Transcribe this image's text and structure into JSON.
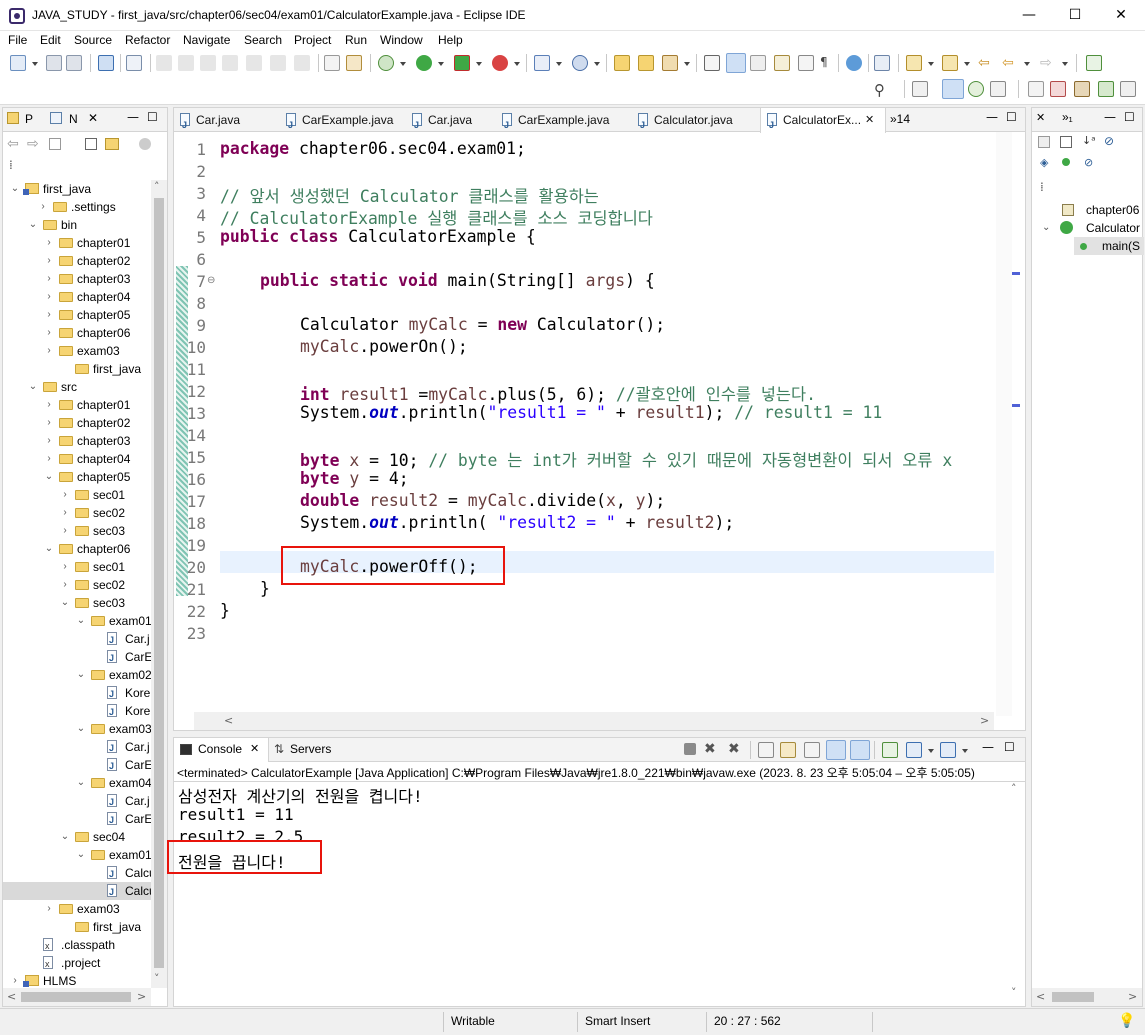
{
  "window": {
    "title": "JAVA_STUDY - first_java/src/chapter06/sec04/exam01/CalculatorExample.java - Eclipse IDE",
    "minimize": "—",
    "maximize": "☐",
    "close": "✕"
  },
  "menu": [
    "File",
    "Edit",
    "Source",
    "Refactor",
    "Navigate",
    "Search",
    "Project",
    "Run",
    "Window",
    "Help"
  ],
  "explorer": {
    "tab_p": "P",
    "tab_n": "N",
    "items": [
      {
        "label": "first_java"
      },
      {
        "label": ".settings"
      },
      {
        "label": "bin"
      },
      {
        "label": "chapter01"
      },
      {
        "label": "chapter02"
      },
      {
        "label": "chapter03"
      },
      {
        "label": "chapter04"
      },
      {
        "label": "chapter05"
      },
      {
        "label": "chapter06"
      },
      {
        "label": "exam03"
      },
      {
        "label": "first_java"
      },
      {
        "label": "src"
      },
      {
        "label": "chapter01"
      },
      {
        "label": "chapter02"
      },
      {
        "label": "chapter03"
      },
      {
        "label": "chapter04"
      },
      {
        "label": "chapter05"
      },
      {
        "label": "sec01"
      },
      {
        "label": "sec02"
      },
      {
        "label": "sec03"
      },
      {
        "label": "chapter06"
      },
      {
        "label": "sec01"
      },
      {
        "label": "sec02"
      },
      {
        "label": "sec03"
      },
      {
        "label": "exam01"
      },
      {
        "label": "Car.j"
      },
      {
        "label": "CarE"
      },
      {
        "label": "exam02"
      },
      {
        "label": "Kore"
      },
      {
        "label": "Kore"
      },
      {
        "label": "exam03"
      },
      {
        "label": "Car.j"
      },
      {
        "label": "CarE"
      },
      {
        "label": "exam04"
      },
      {
        "label": "Car.j"
      },
      {
        "label": "CarE"
      },
      {
        "label": "sec04"
      },
      {
        "label": "exam01"
      },
      {
        "label": "Calcu"
      },
      {
        "label": "Calcu"
      },
      {
        "label": "exam03"
      },
      {
        "label": "first_java"
      },
      {
        "label": ".classpath"
      },
      {
        "label": ".project"
      },
      {
        "label": "HLMS"
      }
    ]
  },
  "editor": {
    "tabs": [
      "Car.java",
      "CarExample.java",
      "Car.java",
      "CarExample.java",
      "Calculator.java",
      "CalculatorEx..."
    ],
    "overflow": "»14",
    "lines": [
      "1",
      "2",
      "3",
      "4",
      "5",
      "6",
      "7",
      "8",
      "9",
      "10",
      "11",
      "12",
      "13",
      "14",
      "15",
      "16",
      "17",
      "18",
      "19",
      "20",
      "21",
      "22",
      "23"
    ],
    "code": {
      "l1_kw": "package",
      "l1_rest": " chapter06.sec04.exam01;",
      "l3": "// 앞서 생성했던 Calculator 클래스를 활용하는",
      "l4": "// CalculatorExample 실행 클래스를 소스 코딩합니다",
      "l5_kw": "public class",
      "l5_rest": " CalculatorExample {",
      "l7_kw": "public static void",
      "l7_rest": " main(String[] ",
      "l7_var": "args",
      "l7_end": ") {",
      "l9_a": "Calculator ",
      "l9_var": "myCalc",
      "l9_b": " = ",
      "l9_kw": "new",
      "l9_c": " Calculator();",
      "l10_var": "myCalc",
      "l10_rest": ".powerOn();",
      "l12_kw": "int",
      "l12_sp": " ",
      "l12_var": "result1",
      "l12_a": " =",
      "l12_var2": "myCalc",
      "l12_b": ".plus(5, 6); ",
      "l12_cm": "//괄호안에 인수를 넣는다.",
      "l13_a": "System.",
      "l13_fld": "out",
      "l13_b": ".println(",
      "l13_st": "\"result1 = \"",
      "l13_c": " + ",
      "l13_var": "result1",
      "l13_d": "); ",
      "l13_cm": "// result1 = 11",
      "l15_kw": "byte",
      "l15_sp": " ",
      "l15_var": "x",
      "l15_a": " = 10; ",
      "l15_cm": "// byte 는 int가 커버할 수 있기 때문에 자동형변환이 되서 오류 x",
      "l16_kw": "byte",
      "l16_sp": " ",
      "l16_var": "y",
      "l16_a": " = 4;",
      "l17_kw": "double",
      "l17_sp": " ",
      "l17_var": "result2",
      "l17_a": " = ",
      "l17_var2": "myCalc",
      "l17_b": ".divide(",
      "l17_var3": "x",
      "l17_c": ", ",
      "l17_var4": "y",
      "l17_d": ");",
      "l18_a": "System.",
      "l18_fld": "out",
      "l18_b": ".println( ",
      "l18_st": "\"result2 = \"",
      "l18_c": " + ",
      "l18_var": "result2",
      "l18_d": ");",
      "l20_var": "myCalc",
      "l20_rest": ".powerOff();",
      "l21": "}",
      "l22": "}"
    }
  },
  "console": {
    "tab_console": "Console",
    "tab_servers": "Servers",
    "header": "<terminated> CalculatorExample [Java Application] C:₩Program Files₩Java₩jre1.8.0_221₩bin₩javaw.exe  (2023. 8. 23 오후 5:05:04 – 오후 5:05:05)",
    "output": [
      "삼성전자 계산기의 전원을 켭니다!",
      "result1 = 11",
      "result2 = 2.5",
      "전원을 끕니다!"
    ]
  },
  "outline": {
    "items": [
      "chapter06",
      "Calculator",
      "main(S"
    ]
  },
  "status": {
    "writable": "Writable",
    "insert": "Smart Insert",
    "position": "20 : 27 : 562"
  },
  "colors": {
    "highlight_box": "#e8140c",
    "keyword": "#7f0055",
    "comment": "#3f7f5f",
    "string": "#2a00ff"
  }
}
